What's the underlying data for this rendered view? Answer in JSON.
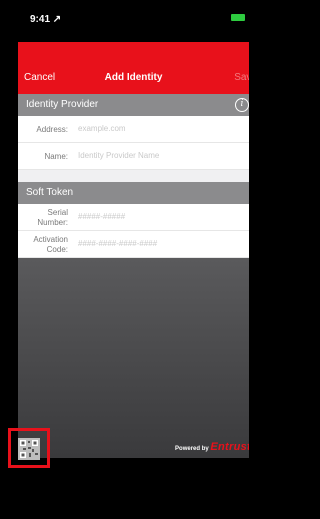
{
  "status": {
    "time": "9:41 ↗"
  },
  "nav": {
    "cancel": "Cancel",
    "title": "Add Identity",
    "save": "Save"
  },
  "identity_provider": {
    "header": "Identity Provider",
    "info_icon": "info-icon",
    "address": {
      "label": "Address:",
      "placeholder": "example.com",
      "value": ""
    },
    "name": {
      "label": "Name:",
      "placeholder": "Identity Provider Name",
      "value": ""
    }
  },
  "soft_token": {
    "header": "Soft Token",
    "serial": {
      "label": "Serial Number:",
      "placeholder": "#####-#####",
      "value": ""
    },
    "activation": {
      "label": "Activation Code:",
      "placeholder": "####-####-####-####",
      "value": ""
    }
  },
  "footer": {
    "powered_by": "Powered by",
    "brand": "Entrust"
  },
  "colors": {
    "accent": "#e8111b",
    "section": "#8b8b8d"
  },
  "qr_button": {
    "icon": "qr-code-icon"
  }
}
